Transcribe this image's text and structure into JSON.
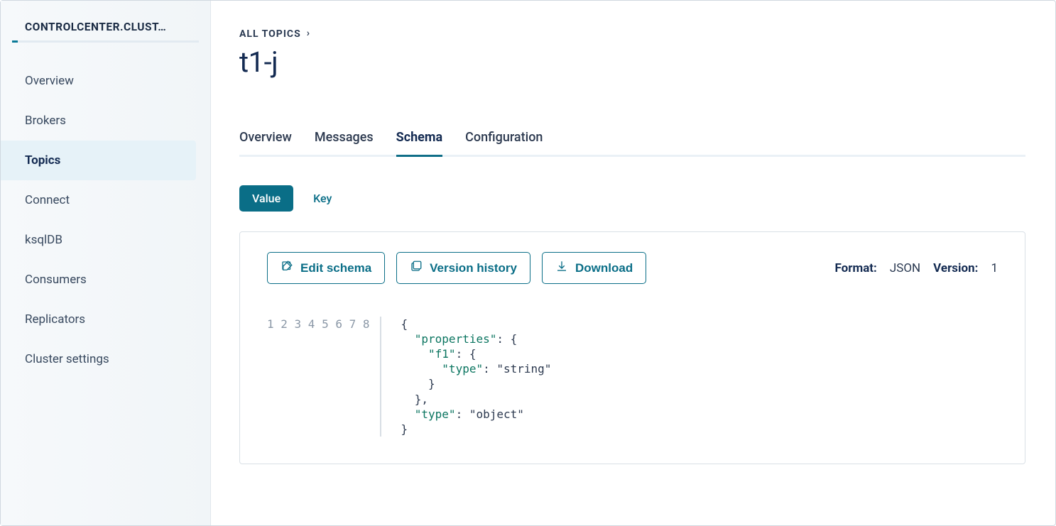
{
  "sidebar": {
    "header": "CONTROLCENTER.CLUST…",
    "items": [
      {
        "label": "Overview",
        "active": false
      },
      {
        "label": "Brokers",
        "active": false
      },
      {
        "label": "Topics",
        "active": true
      },
      {
        "label": "Connect",
        "active": false
      },
      {
        "label": "ksqlDB",
        "active": false
      },
      {
        "label": "Consumers",
        "active": false
      },
      {
        "label": "Replicators",
        "active": false
      },
      {
        "label": "Cluster settings",
        "active": false
      }
    ]
  },
  "breadcrumb": {
    "label": "ALL TOPICS"
  },
  "page_title": "t1-j",
  "tabs": [
    {
      "label": "Overview",
      "active": false
    },
    {
      "label": "Messages",
      "active": false
    },
    {
      "label": "Schema",
      "active": true
    },
    {
      "label": "Configuration",
      "active": false
    }
  ],
  "schema_toggle": {
    "value_label": "Value",
    "key_label": "Key",
    "selected": "Value"
  },
  "actions": {
    "edit": "Edit schema",
    "history": "Version history",
    "download": "Download"
  },
  "meta": {
    "format_label": "Format:",
    "format_value": "JSON",
    "version_label": "Version:",
    "version_value": "1"
  },
  "schema_code": {
    "line_numbers": [
      "1",
      "2",
      "3",
      "4",
      "5",
      "6",
      "7",
      "8"
    ],
    "tokens": [
      [
        {
          "t": "punc",
          "v": "{"
        }
      ],
      [
        {
          "t": "key",
          "v": "\"properties\""
        },
        {
          "t": "punc",
          "v": ": {"
        }
      ],
      [
        {
          "t": "key",
          "v": "\"f1\""
        },
        {
          "t": "punc",
          "v": ": {"
        }
      ],
      [
        {
          "t": "key",
          "v": "\"type\""
        },
        {
          "t": "punc",
          "v": ": "
        },
        {
          "t": "str",
          "v": "\"string\""
        }
      ],
      [
        {
          "t": "punc",
          "v": "}"
        }
      ],
      [
        {
          "t": "punc",
          "v": "},"
        }
      ],
      [
        {
          "t": "key",
          "v": "\"type\""
        },
        {
          "t": "punc",
          "v": ": "
        },
        {
          "t": "str",
          "v": "\"object\""
        }
      ],
      [
        {
          "t": "punc",
          "v": "}"
        }
      ]
    ],
    "indents": [
      0,
      1,
      2,
      3,
      2,
      1,
      1,
      0
    ]
  }
}
